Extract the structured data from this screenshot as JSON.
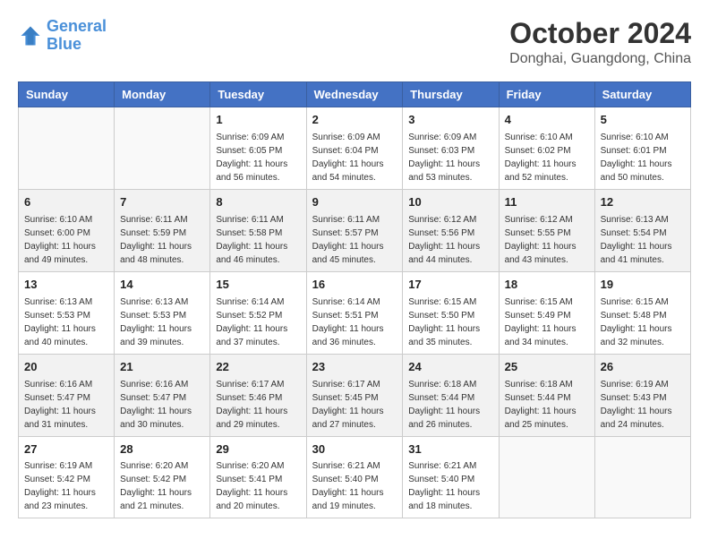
{
  "header": {
    "logo_line1": "General",
    "logo_line2": "Blue",
    "month_year": "October 2024",
    "location": "Donghai, Guangdong, China"
  },
  "weekdays": [
    "Sunday",
    "Monday",
    "Tuesday",
    "Wednesday",
    "Thursday",
    "Friday",
    "Saturday"
  ],
  "weeks": [
    [
      {
        "day": "",
        "info": ""
      },
      {
        "day": "",
        "info": ""
      },
      {
        "day": "1",
        "info": "Sunrise: 6:09 AM\nSunset: 6:05 PM\nDaylight: 11 hours and 56 minutes."
      },
      {
        "day": "2",
        "info": "Sunrise: 6:09 AM\nSunset: 6:04 PM\nDaylight: 11 hours and 54 minutes."
      },
      {
        "day": "3",
        "info": "Sunrise: 6:09 AM\nSunset: 6:03 PM\nDaylight: 11 hours and 53 minutes."
      },
      {
        "day": "4",
        "info": "Sunrise: 6:10 AM\nSunset: 6:02 PM\nDaylight: 11 hours and 52 minutes."
      },
      {
        "day": "5",
        "info": "Sunrise: 6:10 AM\nSunset: 6:01 PM\nDaylight: 11 hours and 50 minutes."
      }
    ],
    [
      {
        "day": "6",
        "info": "Sunrise: 6:10 AM\nSunset: 6:00 PM\nDaylight: 11 hours and 49 minutes."
      },
      {
        "day": "7",
        "info": "Sunrise: 6:11 AM\nSunset: 5:59 PM\nDaylight: 11 hours and 48 minutes."
      },
      {
        "day": "8",
        "info": "Sunrise: 6:11 AM\nSunset: 5:58 PM\nDaylight: 11 hours and 46 minutes."
      },
      {
        "day": "9",
        "info": "Sunrise: 6:11 AM\nSunset: 5:57 PM\nDaylight: 11 hours and 45 minutes."
      },
      {
        "day": "10",
        "info": "Sunrise: 6:12 AM\nSunset: 5:56 PM\nDaylight: 11 hours and 44 minutes."
      },
      {
        "day": "11",
        "info": "Sunrise: 6:12 AM\nSunset: 5:55 PM\nDaylight: 11 hours and 43 minutes."
      },
      {
        "day": "12",
        "info": "Sunrise: 6:13 AM\nSunset: 5:54 PM\nDaylight: 11 hours and 41 minutes."
      }
    ],
    [
      {
        "day": "13",
        "info": "Sunrise: 6:13 AM\nSunset: 5:53 PM\nDaylight: 11 hours and 40 minutes."
      },
      {
        "day": "14",
        "info": "Sunrise: 6:13 AM\nSunset: 5:53 PM\nDaylight: 11 hours and 39 minutes."
      },
      {
        "day": "15",
        "info": "Sunrise: 6:14 AM\nSunset: 5:52 PM\nDaylight: 11 hours and 37 minutes."
      },
      {
        "day": "16",
        "info": "Sunrise: 6:14 AM\nSunset: 5:51 PM\nDaylight: 11 hours and 36 minutes."
      },
      {
        "day": "17",
        "info": "Sunrise: 6:15 AM\nSunset: 5:50 PM\nDaylight: 11 hours and 35 minutes."
      },
      {
        "day": "18",
        "info": "Sunrise: 6:15 AM\nSunset: 5:49 PM\nDaylight: 11 hours and 34 minutes."
      },
      {
        "day": "19",
        "info": "Sunrise: 6:15 AM\nSunset: 5:48 PM\nDaylight: 11 hours and 32 minutes."
      }
    ],
    [
      {
        "day": "20",
        "info": "Sunrise: 6:16 AM\nSunset: 5:47 PM\nDaylight: 11 hours and 31 minutes."
      },
      {
        "day": "21",
        "info": "Sunrise: 6:16 AM\nSunset: 5:47 PM\nDaylight: 11 hours and 30 minutes."
      },
      {
        "day": "22",
        "info": "Sunrise: 6:17 AM\nSunset: 5:46 PM\nDaylight: 11 hours and 29 minutes."
      },
      {
        "day": "23",
        "info": "Sunrise: 6:17 AM\nSunset: 5:45 PM\nDaylight: 11 hours and 27 minutes."
      },
      {
        "day": "24",
        "info": "Sunrise: 6:18 AM\nSunset: 5:44 PM\nDaylight: 11 hours and 26 minutes."
      },
      {
        "day": "25",
        "info": "Sunrise: 6:18 AM\nSunset: 5:44 PM\nDaylight: 11 hours and 25 minutes."
      },
      {
        "day": "26",
        "info": "Sunrise: 6:19 AM\nSunset: 5:43 PM\nDaylight: 11 hours and 24 minutes."
      }
    ],
    [
      {
        "day": "27",
        "info": "Sunrise: 6:19 AM\nSunset: 5:42 PM\nDaylight: 11 hours and 23 minutes."
      },
      {
        "day": "28",
        "info": "Sunrise: 6:20 AM\nSunset: 5:42 PM\nDaylight: 11 hours and 21 minutes."
      },
      {
        "day": "29",
        "info": "Sunrise: 6:20 AM\nSunset: 5:41 PM\nDaylight: 11 hours and 20 minutes."
      },
      {
        "day": "30",
        "info": "Sunrise: 6:21 AM\nSunset: 5:40 PM\nDaylight: 11 hours and 19 minutes."
      },
      {
        "day": "31",
        "info": "Sunrise: 6:21 AM\nSunset: 5:40 PM\nDaylight: 11 hours and 18 minutes."
      },
      {
        "day": "",
        "info": ""
      },
      {
        "day": "",
        "info": ""
      }
    ]
  ]
}
